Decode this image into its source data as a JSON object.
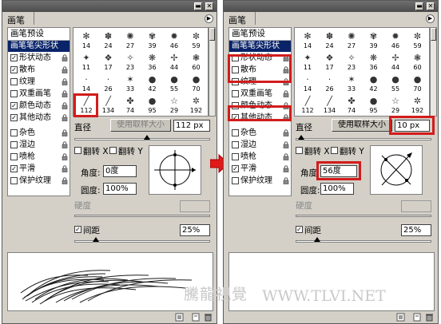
{
  "brushes_for_size": [
    {
      "icon": "✻",
      "size": "14"
    },
    {
      "icon": "✽",
      "size": "24"
    },
    {
      "icon": "✺",
      "size": "27"
    },
    {
      "icon": "✾",
      "size": "39"
    },
    {
      "icon": "✹",
      "size": "46"
    },
    {
      "icon": "✼",
      "size": "59"
    },
    {
      "icon": "✦",
      "size": "11"
    },
    {
      "icon": "❖",
      "size": "17"
    },
    {
      "icon": "✧",
      "size": "23"
    },
    {
      "icon": "❋",
      "size": "36"
    },
    {
      "icon": "✢",
      "size": "44"
    },
    {
      "icon": "❃",
      "size": "60"
    },
    {
      "icon": "·",
      "size": "14"
    },
    {
      "icon": "·",
      "size": "26"
    },
    {
      "icon": "✶",
      "size": "33"
    },
    {
      "icon": "●",
      "size": "42"
    },
    {
      "icon": "●",
      "size": "55"
    },
    {
      "icon": "●",
      "size": "70"
    },
    {
      "icon": "╱",
      "size": "112"
    },
    {
      "icon": "╱",
      "size": "134"
    },
    {
      "icon": "✤",
      "size": "74"
    },
    {
      "icon": "●",
      "size": "95"
    },
    {
      "icon": "☆",
      "size": "29"
    },
    {
      "icon": "✲",
      "size": "192"
    }
  ],
  "colors": {
    "accent_red": "#d21c1c",
    "selection": "#0a246a"
  },
  "left_panel": {
    "title": "画笔",
    "brush_presets": "画笔预设",
    "brush_tip_shape": "画笔笔尖形状",
    "categories": [
      {
        "label": "形状动态",
        "checked": true,
        "lock": true
      },
      {
        "label": "散布",
        "checked": true,
        "lock": true
      },
      {
        "label": "纹理",
        "checked": false,
        "lock": true
      },
      {
        "label": "双重画笔",
        "checked": false,
        "lock": true
      },
      {
        "label": "颜色动态",
        "checked": true,
        "lock": true
      },
      {
        "label": "其他动态",
        "checked": true,
        "lock": true
      },
      {
        "label": "杂色",
        "checked": false,
        "lock": true
      },
      {
        "label": "湿边",
        "checked": false,
        "lock": true
      },
      {
        "label": "喷枪",
        "checked": false,
        "lock": true
      },
      {
        "label": "平滑",
        "checked": true,
        "lock": true
      },
      {
        "label": "保护纹理",
        "checked": false,
        "lock": true
      }
    ],
    "diameter_label": "直径",
    "sample_size_button": "使用取样大小",
    "diameter_value": "112 px",
    "flip_x": "翻转 X",
    "flip_y": "翻转 Y",
    "angle_label": "角度:",
    "angle_value": "0度",
    "roundness_label": "圆度:",
    "roundness_value": "100%",
    "hardness_label": "硬度",
    "spacing_label": "间距",
    "spacing_value": "25%"
  },
  "right_panel": {
    "title": "画笔",
    "brush_presets": "画笔预设",
    "brush_tip_shape": "画笔笔尖形状",
    "categories": [
      {
        "label": "形状动态",
        "checked": false,
        "lock": true
      },
      {
        "label": "散布",
        "checked": false,
        "lock": true
      },
      {
        "label": "纹理",
        "checked": false,
        "lock": true
      },
      {
        "label": "双重画笔",
        "checked": false,
        "lock": true
      },
      {
        "label": "颜色动态",
        "checked": false,
        "lock": true
      },
      {
        "label": "其他动态",
        "checked": true,
        "lock": true
      },
      {
        "label": "杂色",
        "checked": false,
        "lock": true
      },
      {
        "label": "湿边",
        "checked": false,
        "lock": true
      },
      {
        "label": "喷枪",
        "checked": false,
        "lock": true
      },
      {
        "label": "平滑",
        "checked": true,
        "lock": true
      },
      {
        "label": "保护纹理",
        "checked": false,
        "lock": true
      }
    ],
    "diameter_label": "直径",
    "sample_size_button": "使用取样大小",
    "diameter_value": "10 px",
    "flip_x": "翻转 X",
    "flip_y": "翻转 Y",
    "angle_label": "角度",
    "angle_value": "56度",
    "roundness_label": "圆度:",
    "roundness_value": "100%",
    "hardness_label": "硬度",
    "spacing_label": "间距",
    "spacing_value": "25%"
  },
  "watermark": {
    "brand": "騰龍視覺",
    "url": "WWW.TLVI.NET"
  }
}
